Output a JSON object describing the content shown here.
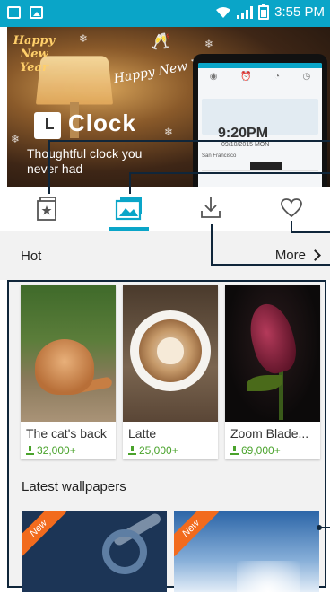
{
  "status_bar": {
    "time": "3:55 PM"
  },
  "banner": {
    "app_name": "Clock",
    "tagline": "Thoughtful clock you never had",
    "greeting_badge": "Happy New Year",
    "greeting_script": "Happy New Year",
    "phone_time": "9:20PM",
    "phone_date": "09/10/2015 MON",
    "phone_city": "San Francisco"
  },
  "tabs": [
    {
      "name": "themes",
      "icon": "theme-book-icon"
    },
    {
      "name": "wallpapers",
      "icon": "wallpaper-image-icon",
      "selected": true
    },
    {
      "name": "downloads",
      "icon": "download-icon"
    },
    {
      "name": "favorites",
      "icon": "heart-icon"
    }
  ],
  "hot_section": {
    "title": "Hot",
    "more_label": "More"
  },
  "hot_items": [
    {
      "caption": "The cat's back",
      "downloads": "32,000+"
    },
    {
      "caption": "Latte",
      "downloads": "25,000+"
    },
    {
      "caption": "Zoom Blade...",
      "downloads": "69,000+"
    }
  ],
  "latest_section": {
    "title": "Latest wallpapers"
  },
  "latest_items": [
    {
      "badge": "New"
    },
    {
      "badge": "New"
    }
  ],
  "colors": {
    "accent": "#0aa5c8",
    "download_green": "#4aa32c",
    "new_badge": "#f26b1d",
    "callout_line": "#10263a"
  }
}
